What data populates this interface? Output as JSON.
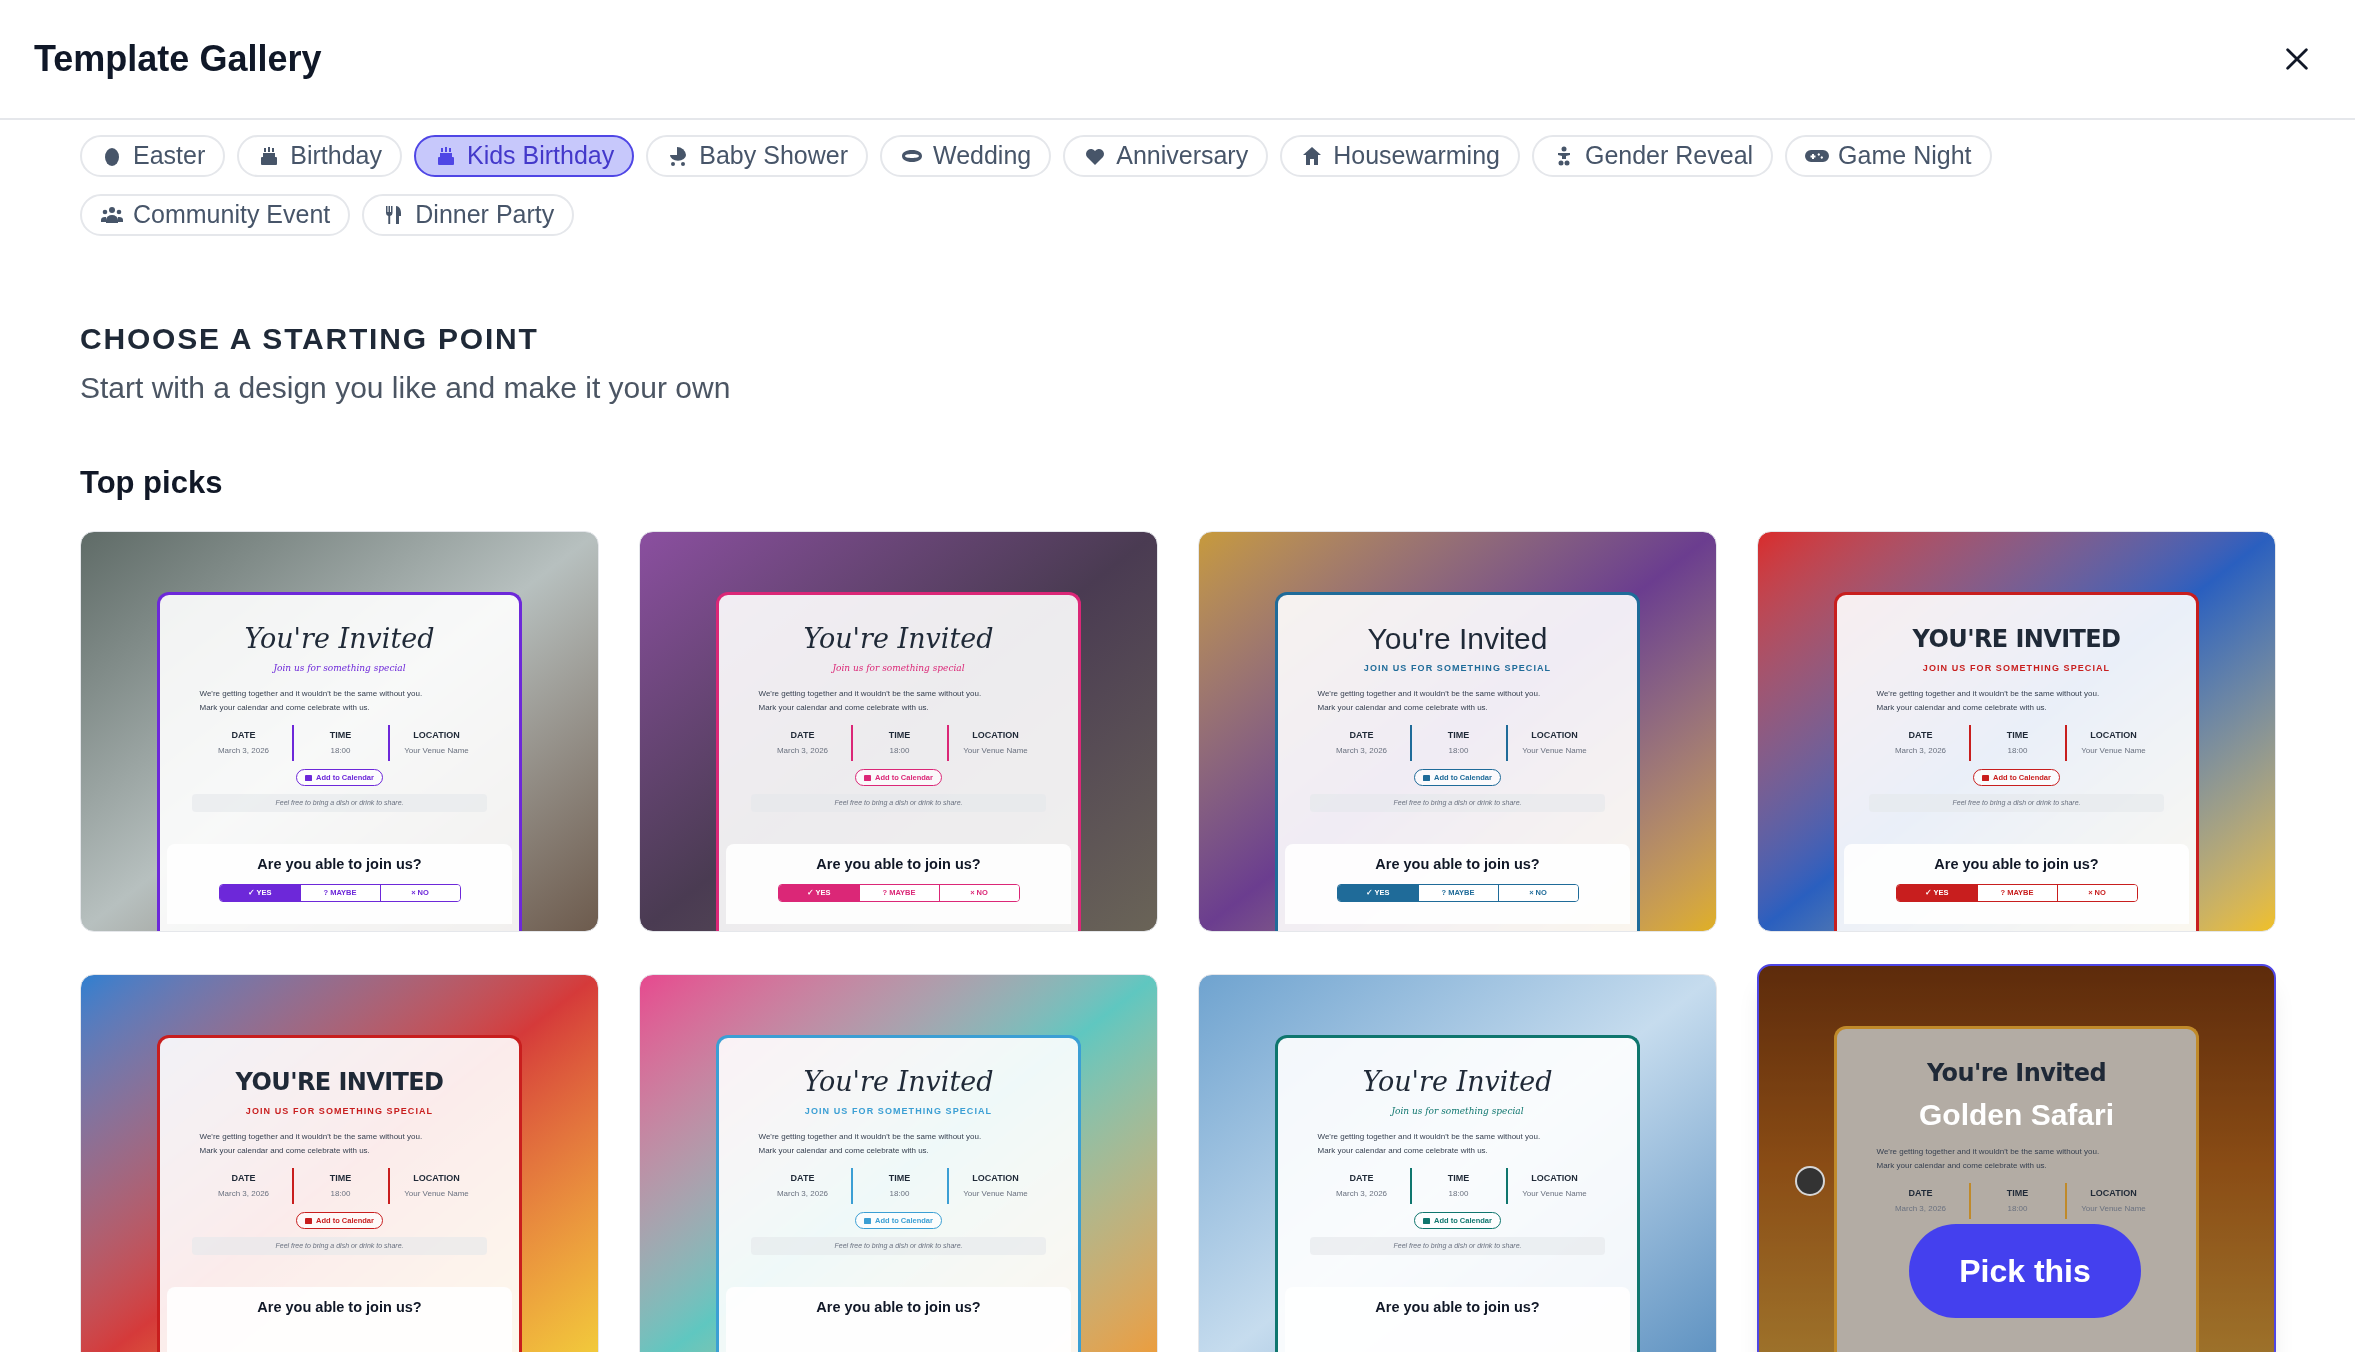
{
  "header": {
    "title": "Template Gallery"
  },
  "categories": [
    {
      "label": "Easter",
      "selected": false
    },
    {
      "label": "Birthday",
      "selected": false
    },
    {
      "label": "Kids Birthday",
      "selected": true
    },
    {
      "label": "Baby Shower",
      "selected": false
    },
    {
      "label": "Wedding",
      "selected": false
    },
    {
      "label": "Anniversary",
      "selected": false
    },
    {
      "label": "Housewarming",
      "selected": false
    },
    {
      "label": "Gender Reveal",
      "selected": false
    },
    {
      "label": "Game Night",
      "selected": false
    },
    {
      "label": "Community Event",
      "selected": false
    },
    {
      "label": "Dinner Party",
      "selected": false
    }
  ],
  "intro": {
    "heading": "CHOOSE A STARTING POINT",
    "subheading": "Start with a design you like and make it your own"
  },
  "section_title": "Top picks",
  "templates": [
    {
      "kind": "script",
      "color": "#6d28d9",
      "hovered": false,
      "title": "You're Invited",
      "subtitle": "Join us for something special",
      "body": [
        "We're getting together and it wouldn't be the same without you.",
        "Mark your calendar and come celebrate with us."
      ],
      "details": [
        {
          "label": "DATE",
          "value": "March 3, 2026"
        },
        {
          "label": "TIME",
          "value": "18:00"
        },
        {
          "label": "LOCATION",
          "value": "Your Venue Name"
        }
      ],
      "calendar": "Add to Calendar",
      "note": "Feel free to bring a dish or drink to share.",
      "question": "Are you able to join us?",
      "rsvp": [
        {
          "label": "✓ YES",
          "selected": true
        },
        {
          "label": "? MAYBE",
          "selected": false
        },
        {
          "label": "× NO",
          "selected": false
        }
      ]
    },
    {
      "kind": "script",
      "color": "#db2777",
      "hovered": false,
      "title": "You're Invited",
      "subtitle": "Join us for something special",
      "body": [
        "We're getting together and it wouldn't be the same without you.",
        "Mark your calendar and come celebrate with us."
      ],
      "details": [
        {
          "label": "DATE",
          "value": "March 3, 2026"
        },
        {
          "label": "TIME",
          "value": "18:00"
        },
        {
          "label": "LOCATION",
          "value": "Your Venue Name"
        }
      ],
      "calendar": "Add to Calendar",
      "note": "Feel free to bring a dish or drink to share.",
      "question": "Are you able to join us?",
      "rsvp": [
        {
          "label": "✓ YES",
          "selected": true
        },
        {
          "label": "? MAYBE",
          "selected": false
        },
        {
          "label": "× NO",
          "selected": false
        }
      ]
    },
    {
      "kind": "sans",
      "color": "#1f6b99",
      "hovered": false,
      "title": "You're Invited",
      "subtitle": "JOIN US FOR SOMETHING SPECIAL",
      "body": [
        "We're getting together and it wouldn't be the same without you.",
        "Mark your calendar and come celebrate with us."
      ],
      "details": [
        {
          "label": "DATE",
          "value": "March 3, 2026"
        },
        {
          "label": "TIME",
          "value": "18:00"
        },
        {
          "label": "LOCATION",
          "value": "Your Venue Name"
        }
      ],
      "calendar": "Add to Calendar",
      "note": "Feel free to bring a dish or drink to share.",
      "question": "Are you able to join us?",
      "rsvp": [
        {
          "label": "✓ YES",
          "selected": true
        },
        {
          "label": "? MAYBE",
          "selected": false
        },
        {
          "label": "× NO",
          "selected": false
        }
      ]
    },
    {
      "kind": "bold",
      "color": "#c81e1e",
      "hovered": false,
      "title": "YOU'RE INVITED",
      "subtitle": "JOIN US FOR SOMETHING SPECIAL",
      "body": [
        "We're getting together and it wouldn't be the same without you.",
        "Mark your calendar and come celebrate with us."
      ],
      "details": [
        {
          "label": "DATE",
          "value": "March 3, 2026"
        },
        {
          "label": "TIME",
          "value": "18:00"
        },
        {
          "label": "LOCATION",
          "value": "Your Venue Name"
        }
      ],
      "calendar": "Add to Calendar",
      "note": "Feel free to bring a dish or drink to share.",
      "question": "Are you able to join us?",
      "rsvp": [
        {
          "label": "✓ YES",
          "selected": true
        },
        {
          "label": "? MAYBE",
          "selected": false
        },
        {
          "label": "× NO",
          "selected": false
        }
      ]
    },
    {
      "kind": "bold",
      "color": "#c81e1e",
      "hovered": false,
      "title": "YOU'RE INVITED",
      "subtitle": "JOIN US FOR SOMETHING SPECIAL",
      "body": [
        "We're getting together and it wouldn't be the same without you.",
        "Mark your calendar and come celebrate with us."
      ],
      "details": [
        {
          "label": "DATE",
          "value": "March 3, 2026"
        },
        {
          "label": "TIME",
          "value": "18:00"
        },
        {
          "label": "LOCATION",
          "value": "Your Venue Name"
        }
      ],
      "calendar": "Add to Calendar",
      "note": "Feel free to bring a dish or drink to share.",
      "question": "Are you able to join us?"
    },
    {
      "kind": "lace",
      "color": "#3b9fd4",
      "hovered": false,
      "title": "You're Invited",
      "subtitle": "JOIN US FOR SOMETHING SPECIAL",
      "body": [
        "We're getting together and it wouldn't be the same without you.",
        "Mark your calendar and come celebrate with us."
      ],
      "details": [
        {
          "label": "DATE",
          "value": "March 3, 2026"
        },
        {
          "label": "TIME",
          "value": "18:00"
        },
        {
          "label": "LOCATION",
          "value": "Your Venue Name"
        }
      ],
      "calendar": "Add to Calendar",
      "note": "Feel free to bring a dish or drink to share.",
      "question": "Are you able to join us?"
    },
    {
      "kind": "script",
      "color": "#0f766e",
      "hovered": false,
      "title": "You're Invited",
      "subtitle": "Join us for something special",
      "body": [
        "We're getting together and it wouldn't be the same without you.",
        "Mark your calendar and come celebrate with us."
      ],
      "details": [
        {
          "label": "DATE",
          "value": "March 3, 2026"
        },
        {
          "label": "TIME",
          "value": "18:00"
        },
        {
          "label": "LOCATION",
          "value": "Your Venue Name"
        }
      ],
      "calendar": "Add to Calendar",
      "note": "Feel free to bring a dish or drink to share.",
      "question": "Are you able to join us?"
    },
    {
      "kind": "bold",
      "color": "#c08a2a",
      "hovered": true,
      "title": "You're Invited",
      "name": "Golden Safari",
      "action": "Pick this",
      "body": [
        "We're getting together and it wouldn't be the same without you.",
        "Mark your calendar and come celebrate with us."
      ],
      "details": [
        {
          "label": "DATE",
          "value": "March 3, 2026"
        },
        {
          "label": "TIME",
          "value": "18:00"
        },
        {
          "label": "LOCATION",
          "value": "Your Venue Name"
        }
      ]
    }
  ]
}
